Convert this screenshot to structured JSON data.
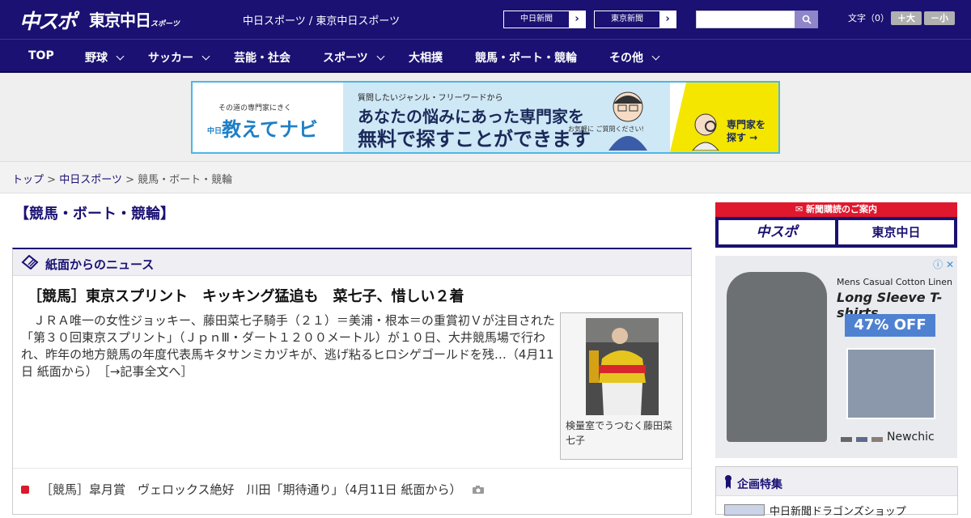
{
  "header": {
    "logo_chuspo": "中スポ",
    "logo_tokyo": "東京中日",
    "logo_tokyo_suffix": "スポーツ",
    "site_names": "中日スポーツ / 東京中日スポーツ",
    "ext_links": [
      "中日新聞",
      "東京新聞"
    ],
    "search_value": "",
    "font_label": "文字（0）",
    "font_plus": "＋大",
    "font_minus": "－小"
  },
  "nav": {
    "items": [
      {
        "label": "TOP"
      },
      {
        "label": "野球"
      },
      {
        "label": "サッカー"
      },
      {
        "label": "芸能・社会"
      },
      {
        "label": "スポーツ"
      },
      {
        "label": "大相撲"
      },
      {
        "label": "競馬・ボート・競輪"
      },
      {
        "label": "その他"
      }
    ]
  },
  "banner": {
    "small": "その道の専門家にきく",
    "logo_prefix": "中日",
    "logo": "教えてナビ",
    "question": "質問したいジャンル・フリーワードから",
    "headline1": "あなたの悩みにあった専門家を",
    "headline2": "無料で探すことができます",
    "note": "お気軽に ご質問ください!",
    "cta": "専門家を 探す →",
    "colors": {
      "border": "#4cb7e6",
      "accent": "#f5e600"
    }
  },
  "breadcrumb": {
    "items": [
      "トップ",
      "中日スポーツ",
      "競馬・ボート・競輪"
    ],
    "separator": ">"
  },
  "main": {
    "page_title": "【競馬・ボート・競輪】",
    "section_title": "紙面からのニュース",
    "article": {
      "title": "［競馬］東京スプリント　キッキング猛追も　菜七子、惜しい２着",
      "body": "　ＪＲＡ唯一の女性ジョッキー、藤田菜七子騎手（２１）＝美浦・根本＝の重賞初Ｖが注目された「第３０回東京スプリント」（ＪｐｎⅢ・ダート１２００メートル）が１０日、大井競馬場で行われ、昨年の地方競馬の年度代表馬キタサンミカヅキが、逃げ粘るヒロシゲゴールドを残…（4月11日 紙面から）　［→記事全文へ］",
      "photo_caption": "検量室でうつむく藤田菜七子"
    },
    "list_items": [
      {
        "text": "［競馬］皐月賞　ヴェロックス絶好　川田「期待通り」（4月11日 紙面から）"
      }
    ]
  },
  "sidebar": {
    "subscribe_head": "新聞購読のご案内",
    "subscribe_logos": [
      "中スポ",
      "東京中日"
    ],
    "ad": {
      "line1": "Mens Casual Cotton Linen",
      "line2": "Long Sleeve T-shirts",
      "discount": "47% OFF",
      "brand": "Newchic",
      "close": "ⓘ ✕"
    },
    "feature_title": "企画特集",
    "feature_item": "中日新聞ドラゴンズショップ"
  },
  "colors": {
    "navy": "#1a1172",
    "red": "#d81b2c"
  }
}
